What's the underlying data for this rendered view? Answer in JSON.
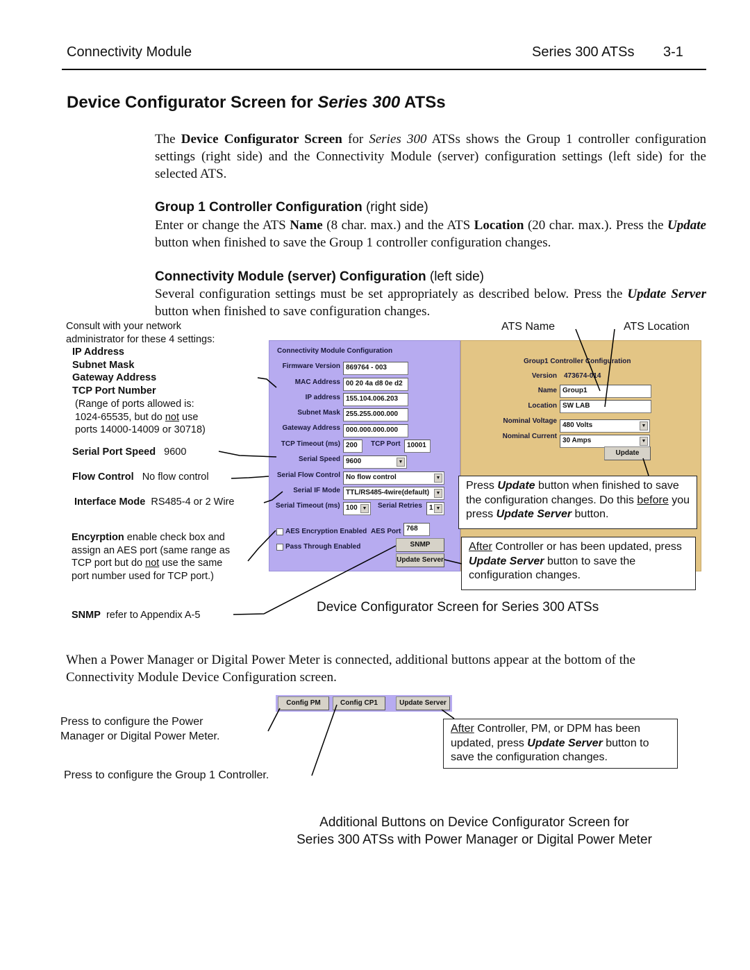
{
  "header": {
    "section": "Connectivity Module",
    "series": "Series 300 ATSs",
    "page_number": "3-1"
  },
  "title": {
    "prefix": "Device Configurator Screen for ",
    "italic": "Series 300",
    "suffix": " ATSs"
  },
  "intro": {
    "p1": "The ",
    "b1": "Device Configurator Screen",
    "p2": " for ",
    "i1": "Series 300",
    "p3": " ATSs shows the Group 1 controller configuration settings (right side) and the Connectivity Module (server) configuration settings (left side) for the selected ATS."
  },
  "group1_section": {
    "heading_bold": "Group 1 Controller Configuration",
    "heading_normal": " (right side)",
    "t1": "Enter or change the ATS ",
    "b1": "Name",
    "t2": " (8 char. max.) and the ATS ",
    "b2": "Location",
    "t3": " (20 char. max.). Press the ",
    "bi1": "Update",
    "t4": " button when finished to save the Group 1 controller configuration changes."
  },
  "cm_section": {
    "heading_bold": "Connectivity Module (server) Configuration",
    "heading_normal": " (left side)",
    "t1": "Several configuration settings must be set appropriately as described below. Press the ",
    "bi1": "Update Server",
    "t2": " button when finished to save configuration changes."
  },
  "left_notes": {
    "consult": "Consult with your network administrator for these 4 settings:",
    "settings": [
      "IP Address",
      "Subnet Mask",
      "Gateway Address",
      "TCP Port Number"
    ],
    "range_1": "(Range of ports allowed is:",
    "range_2a": "1024-65535, but do ",
    "range_2u": "not",
    "range_2b": " use",
    "range_3": "ports 14000-14009 or 30718)",
    "serial_speed_label": "Serial Port Speed",
    "serial_speed_value": "9600",
    "flow_label": "Flow Control",
    "flow_value": "No flow control",
    "iface_label": "Interface Mode",
    "iface_value": "RS485-4 or 2 Wire",
    "enc_label": "Encyrption",
    "enc_t1": "  enable check box and assign an AES port (same range as TCP port but do ",
    "enc_u": "not",
    "enc_t2": " use the same port number used for TCP port.)",
    "snmp_label": "SNMP",
    "snmp_value": "refer to Appendix A-5"
  },
  "callouts_top": {
    "ats_name": "ATS Name",
    "ats_location": "ATS Location"
  },
  "cm_panel": {
    "title": "Connectivity Module Configuration",
    "firmware_label": "Firmware Version",
    "firmware_value": "869764 - 003",
    "mac_label": "MAC Address",
    "mac_value": "00 20 4a d8 0e d2",
    "ip_label": "IP address",
    "ip_value": "155.104.006.203",
    "subnet_label": "Subnet Mask",
    "subnet_value": "255.255.000.000",
    "gateway_label": "Gateway Address",
    "gateway_value": "000.000.000.000",
    "tcp_timeout_label": "TCP Timeout (ms)",
    "tcp_timeout_value": "200",
    "tcp_port_label": "TCP Port",
    "tcp_port_value": "10001",
    "serial_speed_label": "Serial Speed",
    "serial_speed_value": "9600",
    "flow_label": "Serial Flow Control",
    "flow_value": "No flow control",
    "ifmode_label": "Serial IF Mode",
    "ifmode_value": "TTL/RS485-4wire(default)",
    "serial_timeout_label": "Serial Timeout (ms)",
    "serial_timeout_value": "100",
    "serial_retries_label": "Serial Retries",
    "serial_retries_value": "1",
    "aes_label": "AES Encryption Enabled",
    "aes_checked": false,
    "aes_port_label": "AES Port",
    "aes_port_value": "768",
    "passthrough_label": "Pass Through Enabled",
    "passthrough_checked": false,
    "snmp_button": "SNMP",
    "update_server_button": "Update Server"
  },
  "g1_panel": {
    "title": "Group1 Controller Configuration",
    "version_label": "Version",
    "version_value": "473674-014",
    "name_label": "Name",
    "name_value": "Group1",
    "location_label": "Location",
    "location_value": "SW LAB",
    "voltage_label": "Nominal Voltage",
    "voltage_value": "480 Volts",
    "current_label": "Nominal Current",
    "current_value": "30 Amps",
    "update_button": "Update"
  },
  "box1": {
    "t1": "Press ",
    "bi1": "Update",
    "t2": " button when finished to save the configuration changes. Do this ",
    "u1": "before",
    "t3": " you press ",
    "bi2": "Update Server",
    "t4": " button."
  },
  "box2": {
    "u1": "After",
    "t1": " Controller or has been updated, press ",
    "bi1": "Update Server",
    "t2": " button to save the configuration changes."
  },
  "fig1_caption": "Device Configurator Screen for Series 300 ATSs",
  "bottom_para": "When a Power Manager or Digital Power Meter is connected, additional buttons appear at the bottom of the Connectivity Module Device Configuration screen.",
  "extra_buttons": {
    "config_pm": "Config PM",
    "config_cp1": "Config CP1",
    "update_server": "Update Server"
  },
  "extra_notes": {
    "pm": "Press to configure the Power Manager or Digital Power Meter.",
    "cp1": "Press to configure the Group 1 Controller."
  },
  "box3": {
    "u1": "After",
    "t1": " Controller, PM, or DPM has been updated, press ",
    "bi1": "Update Server",
    "t2": " button to save the configuration changes."
  },
  "fig2_caption_1": "Additional Buttons on Device Configurator Screen for",
  "fig2_caption_2": "Series 300 ATSs with Power Manager or Digital Power Meter"
}
